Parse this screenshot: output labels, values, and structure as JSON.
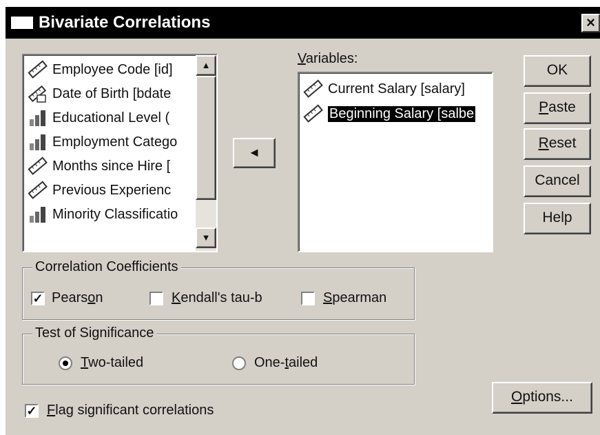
{
  "window": {
    "title": "Bivariate Correlations",
    "close_glyph": "×"
  },
  "source_list": {
    "items": [
      {
        "label": "Employee Code [id]",
        "icon": "ruler-icon"
      },
      {
        "label": "Date of Birth [bdate",
        "icon": "date-icon"
      },
      {
        "label": "Educational Level (",
        "icon": "bar-chart-icon"
      },
      {
        "label": "Employment Catego",
        "icon": "bar-chart-icon"
      },
      {
        "label": "Months since Hire [",
        "icon": "ruler-icon"
      },
      {
        "label": "Previous Experienc",
        "icon": "ruler-icon"
      },
      {
        "label": "Minority Classificatio",
        "icon": "bar-chart-icon"
      }
    ],
    "scroll_up": "▲",
    "scroll_down": "▼"
  },
  "move_button": {
    "glyph": "◄"
  },
  "variables": {
    "label_first": "V",
    "label_rest": "ariables:",
    "items": [
      {
        "label": "Current Salary [salary]",
        "icon": "ruler-icon",
        "selected": false
      },
      {
        "label": "Beginning Salary [salbe",
        "icon": "ruler-icon",
        "selected": true
      }
    ]
  },
  "buttons": {
    "ok": "OK",
    "paste_first": "P",
    "paste_rest": "aste",
    "reset_first": "R",
    "reset_rest": "eset",
    "cancel": "Cancel",
    "help": "Help",
    "options_first": "O",
    "options_rest": "ptions..."
  },
  "correlation": {
    "legend": "Correlation Coefficients",
    "pearson_a": "Pears",
    "pearson_u": "o",
    "pearson_b": "n",
    "kendall_u": "K",
    "kendall_rest": "endall's tau-b",
    "spearman_u": "S",
    "spearman_rest": "pearman",
    "pearson_checked": true,
    "kendall_checked": false,
    "spearman_checked": false,
    "check_glyph": "✓"
  },
  "significance": {
    "legend": "Test of Significance",
    "two_u": "T",
    "two_rest": "wo-tailed",
    "one_a": "One-",
    "one_u": "t",
    "one_rest": "ailed",
    "selected": "two-tailed"
  },
  "flag": {
    "u": "F",
    "rest": "lag significant correlations",
    "checked": true
  }
}
